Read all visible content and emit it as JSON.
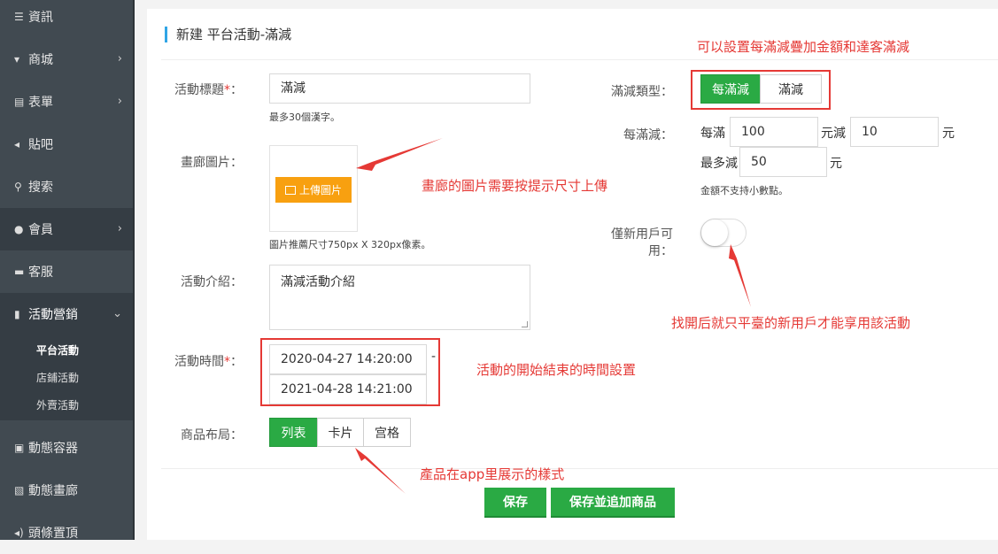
{
  "sidebar": {
    "items": [
      {
        "icon": "list-icon",
        "label": "資訊"
      },
      {
        "icon": "cart-icon",
        "label": "商城"
      },
      {
        "icon": "form-icon",
        "label": "表單"
      },
      {
        "icon": "megaphone-icon",
        "label": "貼吧"
      },
      {
        "icon": "search-icon",
        "label": "搜索"
      },
      {
        "icon": "bell-icon",
        "label": "會員"
      },
      {
        "icon": "chat-icon",
        "label": "客服"
      },
      {
        "icon": "bookmark-icon",
        "label": "活動營銷"
      },
      {
        "icon": "storage-icon",
        "label": "動態容器"
      },
      {
        "icon": "image-icon",
        "label": "動態畫廊"
      },
      {
        "icon": "volume-icon",
        "label": "頭條置頂"
      }
    ],
    "sub_items": [
      "平台活動",
      "店鋪活動",
      "外賣活動"
    ]
  },
  "page": {
    "title": "新建 平台活動-滿減"
  },
  "form": {
    "title_label": "活動標題",
    "title_value": "滿減",
    "title_hint": "最多30個漢字。",
    "gallery_label": "畫廊圖片：",
    "upload_label": "上傳圖片",
    "gallery_hint": "圖片推薦尺寸750px X 320px像素。",
    "intro_label": "活動介紹：",
    "intro_value": "滿減活動介紹",
    "time_label": "活動時間",
    "start_time": "2020-04-27 14:20:00",
    "end_time": "2021-04-28 14:21:00",
    "time_sep": "-",
    "layout_label": "商品布局：",
    "layout_options": [
      "列表",
      "卡片",
      "宫格"
    ],
    "reduce_type_label": "滿減類型：",
    "reduce_type_options": [
      "每滿減",
      "滿減"
    ],
    "per_reduce_label": "每滿減：",
    "per_full_prefix": "每滿",
    "per_full_value": "100",
    "reduce_mid": "元減",
    "reduce_value": "10",
    "unit_yuan": "元",
    "max_reduce_prefix": "最多減",
    "max_reduce_value": "50",
    "amount_hint": "金額不支持小數點。",
    "new_user_label_1": "僅新用戶可",
    "new_user_label_2": "用：",
    "colon": "：",
    "required_mark": "*"
  },
  "buttons": {
    "save": "保存",
    "save_add": "保存並追加商品"
  },
  "annotations": {
    "reduce_type_note": "可以設置每滿減疊加金額和達客滿減",
    "gallery_note": "畫廊的圖片需要按提示尺寸上傳",
    "new_user_note": "找開后就只平臺的新用戶才能享用該活動",
    "time_note": "活動的開始結束的時間設置",
    "layout_note": "產品在app里展示的樣式"
  },
  "colors": {
    "accent": "#2aaa44",
    "upload": "#f8a010",
    "annotation": "#e53935",
    "sidebar": "#414a51"
  }
}
